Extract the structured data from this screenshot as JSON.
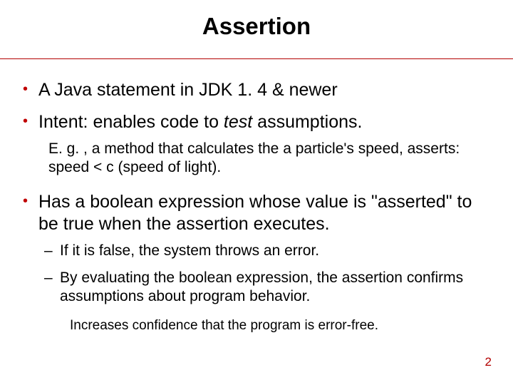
{
  "title": "Assertion",
  "bullets": {
    "b1": "A Java statement in JDK 1. 4 & newer",
    "b2_pre": "Intent: enables code to ",
    "b2_ital": "test",
    "b2_post": " assumptions.",
    "b2_sub": "E. g. , a method that calculates the a particle's speed, asserts: speed < c (speed of light).",
    "b3": "Has a boolean expression whose value is \"asserted\" to be true when the assertion executes.",
    "b3_d1": "If it is false, the system throws an error.",
    "b3_d2": "By evaluating the boolean expression, the assertion confirms assumptions about program behavior.",
    "b3_deep": "Increases confidence that the program is error-free."
  },
  "page_number": "2"
}
